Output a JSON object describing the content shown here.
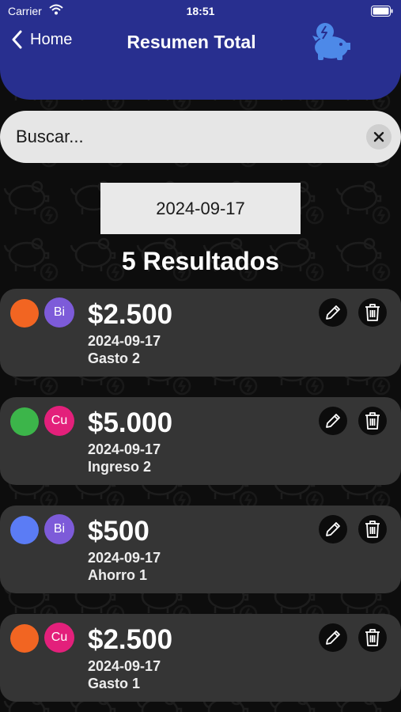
{
  "status_bar": {
    "carrier": "Carrier",
    "time": "18:51"
  },
  "header": {
    "back_label": "Home",
    "title": "Resumen Total",
    "logo_icon": "piggy-bank-icon"
  },
  "search": {
    "placeholder": "Buscar...",
    "value": ""
  },
  "date_filter": {
    "value": "2024-09-17"
  },
  "results_label": "5 Resultados",
  "colors": {
    "header": "#282f8f",
    "card": "#353535",
    "search": "#e6e6e6",
    "date_button": "#e9e9e9"
  },
  "transactions": [
    {
      "amount": "$2.500",
      "date": "2024-09-17",
      "name": "Gasto 2",
      "category_color": "#f26522",
      "account": {
        "initials": "Bi",
        "color": "#7d5bd9"
      }
    },
    {
      "amount": "$5.000",
      "date": "2024-09-17",
      "name": "Ingreso 2",
      "category_color": "#3cb54a",
      "account": {
        "initials": "Cu",
        "color": "#e3207b"
      }
    },
    {
      "amount": "$500",
      "date": "2024-09-17",
      "name": "Ahorro 1",
      "category_color": "#5b7cf5",
      "account": {
        "initials": "Bi",
        "color": "#7d5bd9"
      }
    },
    {
      "amount": "$2.500",
      "date": "2024-09-17",
      "name": "Gasto 1",
      "category_color": "#f26522",
      "account": {
        "initials": "Cu",
        "color": "#e3207b"
      }
    }
  ]
}
